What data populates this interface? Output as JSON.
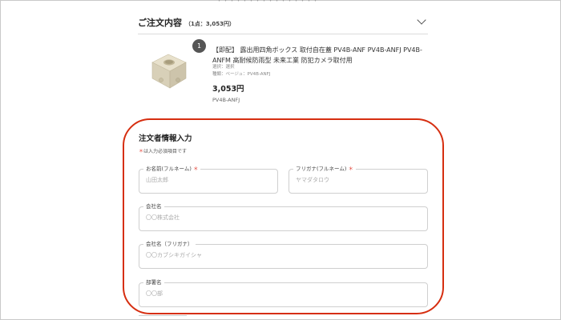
{
  "order_summary": {
    "title": "ご注文内容",
    "count_text": "（1点：3,053円）"
  },
  "product": {
    "quantity": "1",
    "name": "【即配】 露出用四角ボックス 取付自在蓋 PV4B-ANF PV4B-ANFJ PV4B-ANFM 高耐候防雨型 未来工業 防犯カメラ取付用",
    "variant_line1": "選択：選択",
    "variant_line2": "種類：ベージュ：PV4B-ANFJ",
    "price": "3,053円",
    "sku": "PV4B-ANFJ"
  },
  "customer_form": {
    "title": "注文者情報入力",
    "required_mark": "＊",
    "required_note": "は入力必須項目です",
    "fields": [
      {
        "label": "お名前(フルネーム)",
        "required_mark": "＊",
        "placeholder": "山田太郎"
      },
      {
        "label": "フリガナ(フルネーム)",
        "required_mark": "＊",
        "placeholder": "ヤマダタロウ"
      },
      {
        "label": "会社名",
        "placeholder": "〇〇株式会社"
      },
      {
        "label": "会社名（フリガナ）",
        "placeholder": "〇〇カブシキガイシャ"
      },
      {
        "label": "部署名",
        "placeholder": "〇〇部"
      }
    ]
  },
  "colors": {
    "highlight_border": "#d62e10",
    "required_star": "#e03a2e",
    "badge_bg": "#555555"
  }
}
